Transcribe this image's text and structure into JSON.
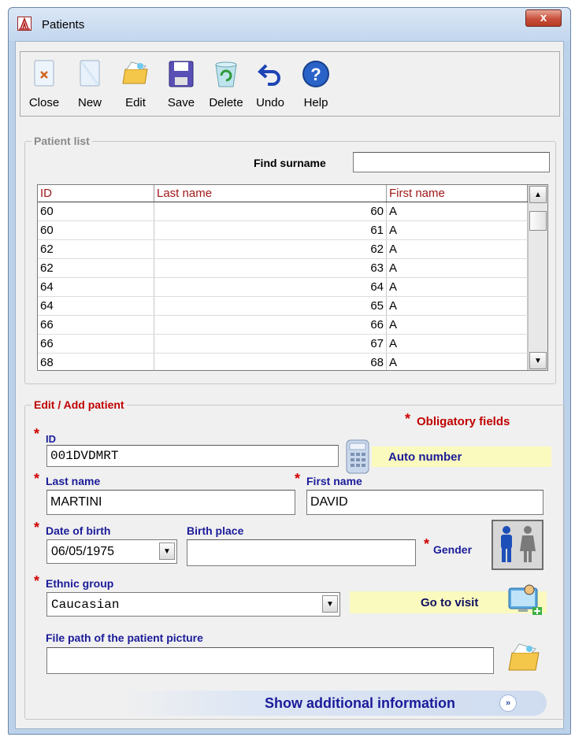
{
  "window": {
    "title": "Patients",
    "close_glyph": "x"
  },
  "toolbar": {
    "buttons": [
      {
        "label": "Close",
        "icon": "close-document-icon"
      },
      {
        "label": "New",
        "icon": "new-document-icon"
      },
      {
        "label": "Edit",
        "icon": "edit-folder-icon"
      },
      {
        "label": "Save",
        "icon": "floppy-disk-icon"
      },
      {
        "label": "Delete",
        "icon": "recycle-bin-icon"
      },
      {
        "label": "Undo",
        "icon": "undo-arrow-icon"
      },
      {
        "label": "Help",
        "icon": "help-icon"
      }
    ]
  },
  "patient_list": {
    "legend": "Patient list",
    "find_label": "Find surname",
    "find_value": "",
    "columns": [
      "ID",
      "Last name",
      "First name"
    ],
    "rows": [
      [
        "60",
        "60",
        "A"
      ],
      [
        "60",
        "61",
        "A"
      ],
      [
        "62",
        "62",
        "A"
      ],
      [
        "62",
        "63",
        "A"
      ],
      [
        "64",
        "64",
        "A"
      ],
      [
        "64",
        "65",
        "A"
      ],
      [
        "66",
        "66",
        "A"
      ],
      [
        "66",
        "67",
        "A"
      ],
      [
        "68",
        "68",
        "A"
      ]
    ]
  },
  "edit_patient": {
    "legend": "Edit / Add patient",
    "obligatory_label": "Obligatory fields",
    "required_mark": "*",
    "id_label": "ID",
    "id_value": "001DVDMRT",
    "auto_number_label": "Auto number",
    "last_name_label": "Last name",
    "last_name_value": "MARTINI",
    "first_name_label": "First name",
    "first_name_value": "DAVID",
    "dob_label": "Date of birth",
    "dob_value": "06/05/1975",
    "birth_place_label": "Birth place",
    "birth_place_value": "",
    "gender_label": "Gender",
    "ethnic_label": "Ethnic group",
    "ethnic_value": "Caucasian",
    "go_visit_label": "Go to visit",
    "picture_label": "File path of the patient picture",
    "picture_value": "",
    "show_more_label": "Show additional information",
    "show_more_glyph": "»"
  },
  "colors": {
    "required": "#d00000",
    "label_blue": "#1b1b9a",
    "header_red": "#a01818",
    "highlight_yellow": "#fafabe"
  }
}
